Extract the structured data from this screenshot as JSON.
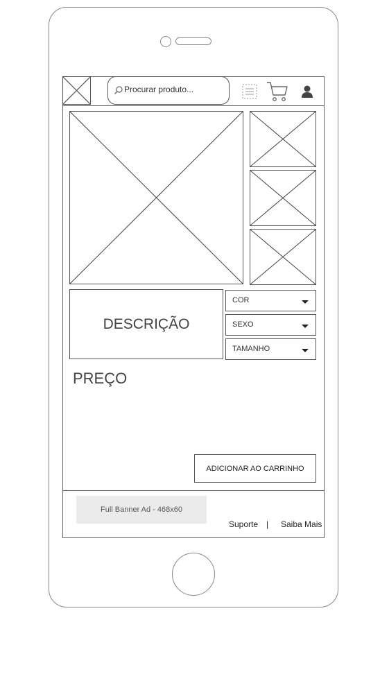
{
  "header": {
    "search_placeholder": "Procurar produto..."
  },
  "product": {
    "description_label": "DESCRIÇÃO",
    "price_label": "PREÇO",
    "options": [
      {
        "label": "COR"
      },
      {
        "label": "SEXO"
      },
      {
        "label": "TAMANHO"
      }
    ],
    "add_to_cart_label": "ADICIONAR AO CARRINHO"
  },
  "footer": {
    "banner_label": "Full Banner Ad - 468x60",
    "link_support": "Suporte",
    "separator": "|",
    "link_more": "Saiba Mais"
  },
  "icons": {
    "logo": "image-placeholder-icon",
    "search": "search-icon",
    "menu": "menu-icon",
    "cart": "cart-icon",
    "user": "user-icon"
  }
}
